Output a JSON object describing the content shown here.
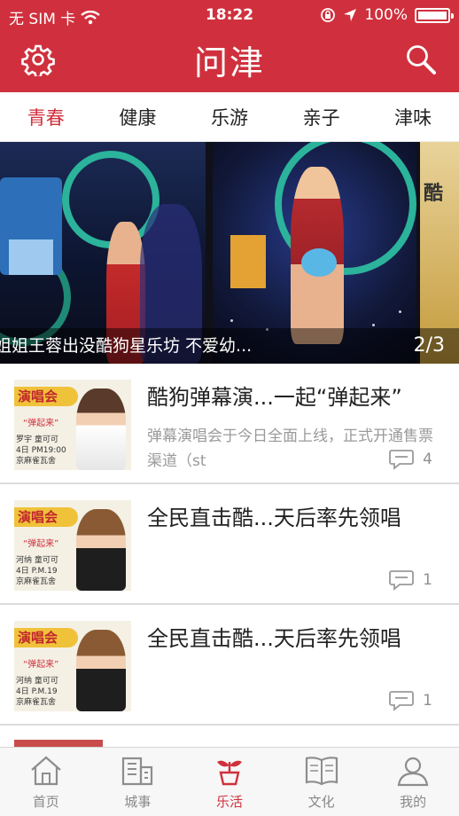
{
  "status_bar": {
    "carrier": "无 SIM 卡",
    "time": "18:22",
    "battery": "100%"
  },
  "header": {
    "title": "问津"
  },
  "tabs": [
    {
      "label": "青春",
      "active": true
    },
    {
      "label": "健康",
      "active": false
    },
    {
      "label": "乐游",
      "active": false
    },
    {
      "label": "亲子",
      "active": false
    },
    {
      "label": "津味",
      "active": false
    }
  ],
  "banner": {
    "caption": "姐姐王蓉出没酷狗星乐坊 不爱幼...",
    "pager": "2/3"
  },
  "news": [
    {
      "title": "酷狗弹幕演...一起“弹起来”",
      "description": "弹幕演唱会于今日全面上线，正式开通售票渠道（st",
      "comments": "4",
      "thumb_band": "演唱会",
      "thumb_sub": "“弹起来”",
      "thumb_info": [
        "罗宇 童可可",
        "4日 PM19:00",
        "京麻雀瓦舍"
      ]
    },
    {
      "title": "全民直击酷...天后率先领唱",
      "description": "",
      "comments": "1",
      "thumb_band": "演唱会",
      "thumb_sub": "“弹起来”",
      "thumb_info": [
        "河纳 童可可",
        "4日 P.M.19",
        "京麻雀瓦舍"
      ]
    },
    {
      "title": "全民直击酷...天后率先领唱",
      "description": "",
      "comments": "1",
      "thumb_band": "演唱会",
      "thumb_sub": "“弹起来”",
      "thumb_info": [
        "河纳 童可可",
        "4日 P.M.19",
        "京麻雀瓦舍"
      ]
    }
  ],
  "tabbar": [
    {
      "label": "首页",
      "icon": "home-icon",
      "active": false
    },
    {
      "label": "城事",
      "icon": "city-icon",
      "active": false
    },
    {
      "label": "乐活",
      "icon": "sprout-icon",
      "active": true
    },
    {
      "label": "文化",
      "icon": "book-icon",
      "active": false
    },
    {
      "label": "我的",
      "icon": "user-icon",
      "active": false
    }
  ],
  "colors": {
    "brand": "#d0303d",
    "muted": "#9a9a9a"
  }
}
